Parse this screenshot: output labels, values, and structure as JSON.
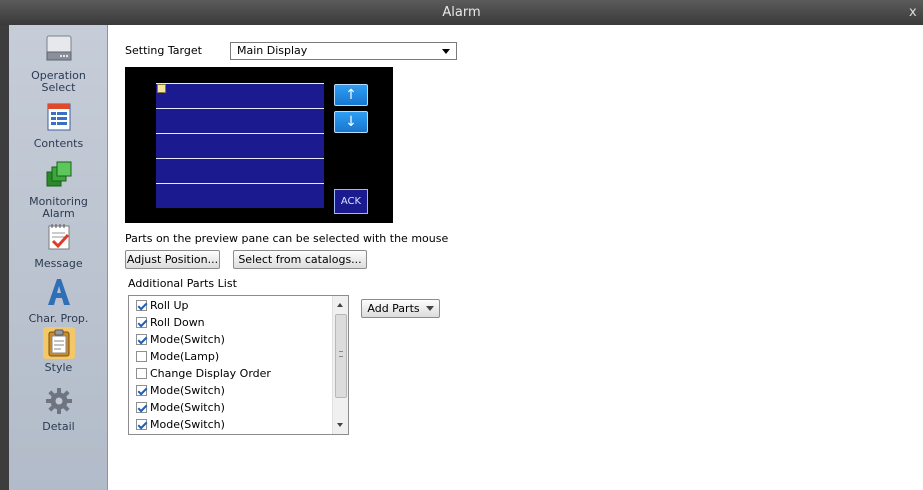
{
  "window": {
    "title": "Alarm",
    "close_glyph": "x"
  },
  "sidebar": {
    "items": [
      {
        "label_line1": "Operation",
        "label_line2": "Select",
        "icon": "drive-icon"
      },
      {
        "label_line1": "Contents",
        "label_line2": "",
        "icon": "list-document-icon"
      },
      {
        "label_line1": "Monitoring",
        "label_line2": "Alarm",
        "icon": "green-stack-icon"
      },
      {
        "label_line1": "Message",
        "label_line2": "",
        "icon": "message-check-icon"
      },
      {
        "label_line1": "Char. Prop.",
        "label_line2": "",
        "icon": "letter-a-icon"
      },
      {
        "label_line1": "Style",
        "label_line2": "",
        "icon": "clipboard-icon",
        "active": true
      },
      {
        "label_line1": "Detail",
        "label_line2": "",
        "icon": "gear-icon"
      }
    ]
  },
  "setting_target": {
    "label": "Setting Target",
    "value": "Main Display"
  },
  "preview": {
    "up_glyph": "↑",
    "down_glyph": "↓",
    "ack_label": "ACK",
    "hint": "Parts on the preview pane can be selected with the mouse"
  },
  "buttons": {
    "adjust_position": "Adjust Position...",
    "select_from_catalogs": "Select from catalogs..."
  },
  "additional_parts": {
    "label": "Additional Parts List",
    "items": [
      {
        "label": "Roll Up",
        "checked": true
      },
      {
        "label": "Roll Down",
        "checked": true
      },
      {
        "label": "Mode(Switch)",
        "checked": true
      },
      {
        "label": "Mode(Lamp)",
        "checked": false
      },
      {
        "label": "Change Display Order",
        "checked": false
      },
      {
        "label": "Mode(Switch)",
        "checked": true
      },
      {
        "label": "Mode(Switch)",
        "checked": true
      },
      {
        "label": "Mode(Switch)",
        "checked": true
      }
    ],
    "add_parts_label": "Add Parts"
  },
  "colors": {
    "preview_row": "#1b1b8f",
    "preview_button": "#1776d0",
    "sidebar_bg": "#c6cdd8",
    "active_highlight": "#f2c868"
  }
}
